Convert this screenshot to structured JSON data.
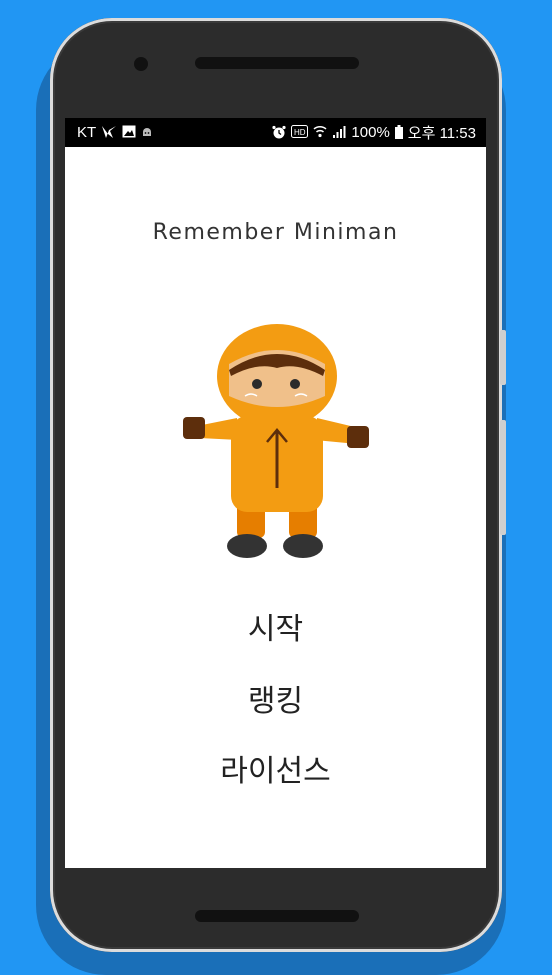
{
  "statusbar": {
    "carrier": "KT",
    "icons_left": [
      "volte-icon",
      "image-icon",
      "android-icon"
    ],
    "icons_right": [
      "alarm-icon",
      "hd-icon",
      "wifi-icon",
      "signal-icon"
    ],
    "battery": "100%",
    "time": "오후 11:53"
  },
  "app": {
    "title": "Remember Miniman"
  },
  "menu": {
    "start": "시작",
    "ranking": "랭킹",
    "license": "라이선스"
  },
  "colors": {
    "background": "#2196F3",
    "mascot_orange": "#F39C12",
    "mascot_dark_orange": "#E67E00"
  }
}
